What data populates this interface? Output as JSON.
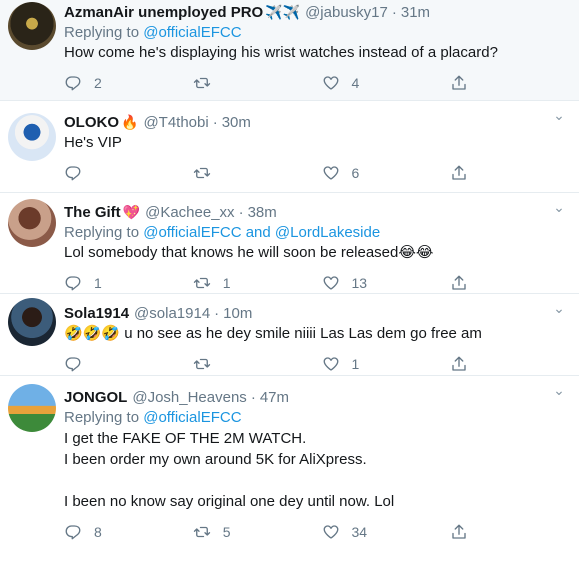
{
  "tweets": [
    {
      "name": "AzmanAir unemployed PRO",
      "name_emoji": "✈️✈️",
      "handle": "@jabusky17",
      "time": "31m",
      "replying_prefix": "Replying to",
      "replying_to": "@officialEFCC",
      "text": "How come he's displaying his wrist watches instead of a placard?",
      "replies": "2",
      "retweets": "",
      "likes": "4"
    },
    {
      "name": "OLOKO",
      "name_emoji": "🔥",
      "handle": "@T4thobi",
      "time": "30m",
      "text": "He's VIP",
      "replies": "",
      "retweets": "",
      "likes": "6"
    },
    {
      "name": "The Gift",
      "name_emoji": "💖",
      "handle": "@Kachee_xx",
      "time": "38m",
      "replying_prefix": "Replying to",
      "replying_to": "@officialEFCC",
      "replying_and": "and",
      "replying_to_2": "@LordLakeside",
      "text": "Lol somebody that knows he will soon be released😂😂",
      "replies": "1",
      "retweets": "1",
      "likes": "13"
    },
    {
      "name": "Sola1914",
      "name_emoji": "",
      "handle": "@sola1914",
      "time": "10m",
      "text": "🤣🤣🤣 u no see as he dey smile niiii Las Las dem go free am",
      "replies": "",
      "retweets": "",
      "likes": "1"
    },
    {
      "name": "JONGOL",
      "name_emoji": "",
      "handle": "@Josh_Heavens",
      "time": "47m",
      "replying_prefix": "Replying to",
      "replying_to": "@officialEFCC",
      "text": "I get the FAKE OF THE 2M WATCH.\nI been order my own around 5K for AliXpress.\n\nI been no know say original one dey until now. Lol",
      "replies": "8",
      "retweets": "5",
      "likes": "34"
    }
  ],
  "dot": "·",
  "icons": {
    "reply": "reply-icon",
    "retweet": "retweet-icon",
    "like": "heart-icon",
    "share": "share-icon",
    "caret": "chevron-down-icon"
  },
  "colors": {
    "link": "#1b95e0",
    "secondary": "#657786",
    "highlight_bg": "#f5f8fa",
    "divider": "#e6ecf0"
  }
}
